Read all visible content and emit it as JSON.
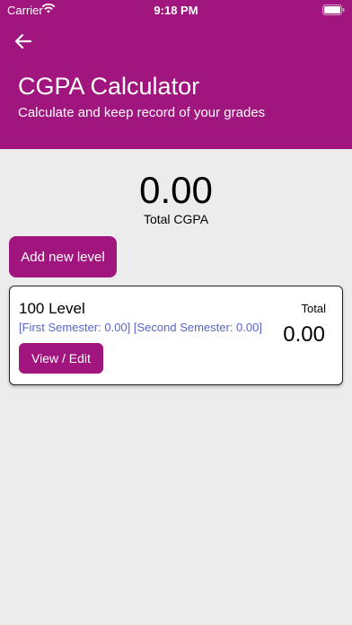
{
  "status_bar": {
    "carrier": "Carrier",
    "time": "9:18 PM"
  },
  "header": {
    "title": "CGPA Calculator",
    "subtitle": "Calculate and keep record of your grades",
    "color": "#a1157e"
  },
  "summary": {
    "total_value": "0.00",
    "total_label": "Total CGPA"
  },
  "actions": {
    "add_level_label": "Add new level"
  },
  "levels": [
    {
      "title": "100 Level",
      "semesters": "[First Semester: 0.00] [Second Semester: 0.00]",
      "total_label": "Total",
      "total_value": "0.00",
      "edit_label": "View / Edit"
    }
  ],
  "icons": {
    "back": "arrow-left-icon",
    "wifi": "wifi-icon",
    "battery": "battery-icon"
  }
}
